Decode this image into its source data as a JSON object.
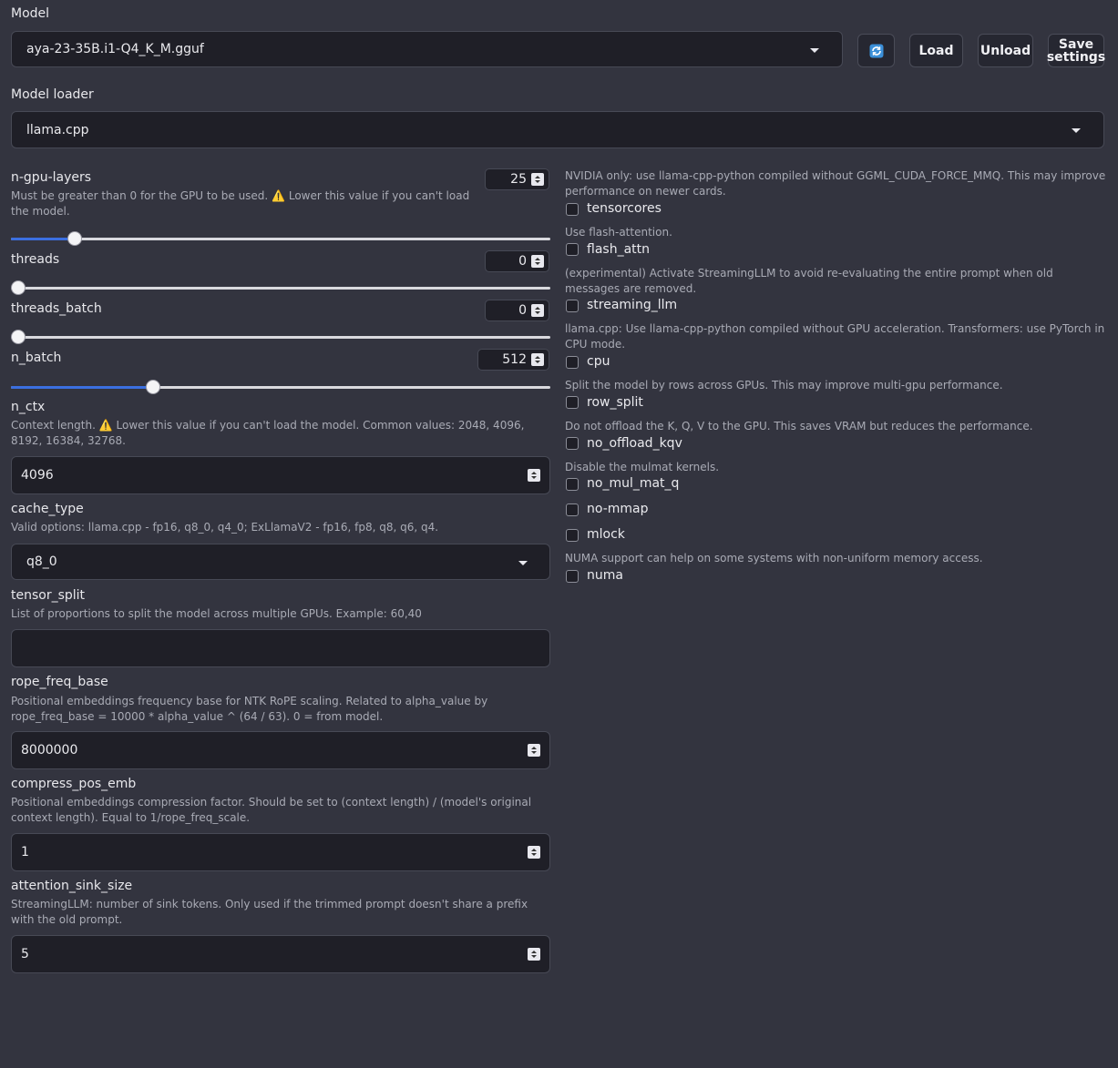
{
  "model": {
    "label": "Model",
    "selected": "aya-23-35B.i1-Q4_K_M.gguf",
    "refresh_icon": "refresh-icon",
    "load_label": "Load",
    "unload_label": "Unload",
    "save_label_1": "Save",
    "save_label_2": "settings"
  },
  "loader": {
    "label": "Model loader",
    "selected": "llama.cpp"
  },
  "params": {
    "n_gpu_layers": {
      "label": "n-gpu-layers",
      "value": "25",
      "fraction": 0.108,
      "info_1": "Must be greater than 0 for the GPU to be used.",
      "warn": "⚠️",
      "info_2": "Lower this value if you can't load the model."
    },
    "threads": {
      "label": "threads",
      "value": "0",
      "fraction": 0.0
    },
    "threads_batch": {
      "label": "threads_batch",
      "value": "0",
      "fraction": 0.0
    },
    "n_batch": {
      "label": "n_batch",
      "value": "512",
      "fraction": 0.257
    },
    "n_ctx": {
      "label": "n_ctx",
      "value": "4096",
      "info_1": "Context length.",
      "warn": "⚠️",
      "info_2": "Lower this value if you can't load the model. Common values: 2048, 4096, 8192, 16384, 32768."
    },
    "cache_type": {
      "label": "cache_type",
      "info": "Valid options: llama.cpp - fp16, q8_0, q4_0; ExLlamaV2 - fp16, fp8, q8, q6, q4.",
      "selected": "q8_0"
    },
    "tensor_split": {
      "label": "tensor_split",
      "info": "List of proportions to split the model across multiple GPUs. Example: 60,40",
      "value": ""
    },
    "rope_freq_base": {
      "label": "rope_freq_base",
      "info": "Positional embeddings frequency base for NTK RoPE scaling. Related to alpha_value by rope_freq_base = 10000 * alpha_value ^ (64 / 63). 0 = from model.",
      "value": "8000000"
    },
    "compress_pos_emb": {
      "label": "compress_pos_emb",
      "info": "Positional embeddings compression factor. Should be set to (context length) / (model's original context length). Equal to 1/rope_freq_scale.",
      "value": "1"
    },
    "attention_sink_size": {
      "label": "attention_sink_size",
      "info": "StreamingLLM: number of sink tokens. Only used if the trimmed prompt doesn't share a prefix with the old prompt.",
      "value": "5"
    }
  },
  "flags": [
    {
      "info": "NVIDIA only: use llama-cpp-python compiled without GGML_CUDA_FORCE_MMQ. This may improve performance on newer cards.",
      "label": "tensorcores"
    },
    {
      "info": "Use flash-attention.",
      "label": "flash_attn"
    },
    {
      "info": "(experimental) Activate StreamingLLM to avoid re-evaluating the entire prompt when old messages are removed.",
      "label": "streaming_llm"
    },
    {
      "info": "llama.cpp: Use llama-cpp-python compiled without GPU acceleration. Transformers: use PyTorch in CPU mode.",
      "label": "cpu"
    },
    {
      "info": "Split the model by rows across GPUs. This may improve multi-gpu performance.",
      "label": "row_split"
    },
    {
      "info": "Do not offload the K, Q, V to the GPU. This saves VRAM but reduces the performance.",
      "label": "no_offload_kqv"
    },
    {
      "info": "Disable the mulmat kernels.",
      "label": "no_mul_mat_q"
    },
    {
      "info": "",
      "label": "no-mmap"
    },
    {
      "info": "",
      "label": "mlock"
    },
    {
      "info": "NUMA support can help on some systems with non-uniform memory access.",
      "label": "numa"
    }
  ]
}
